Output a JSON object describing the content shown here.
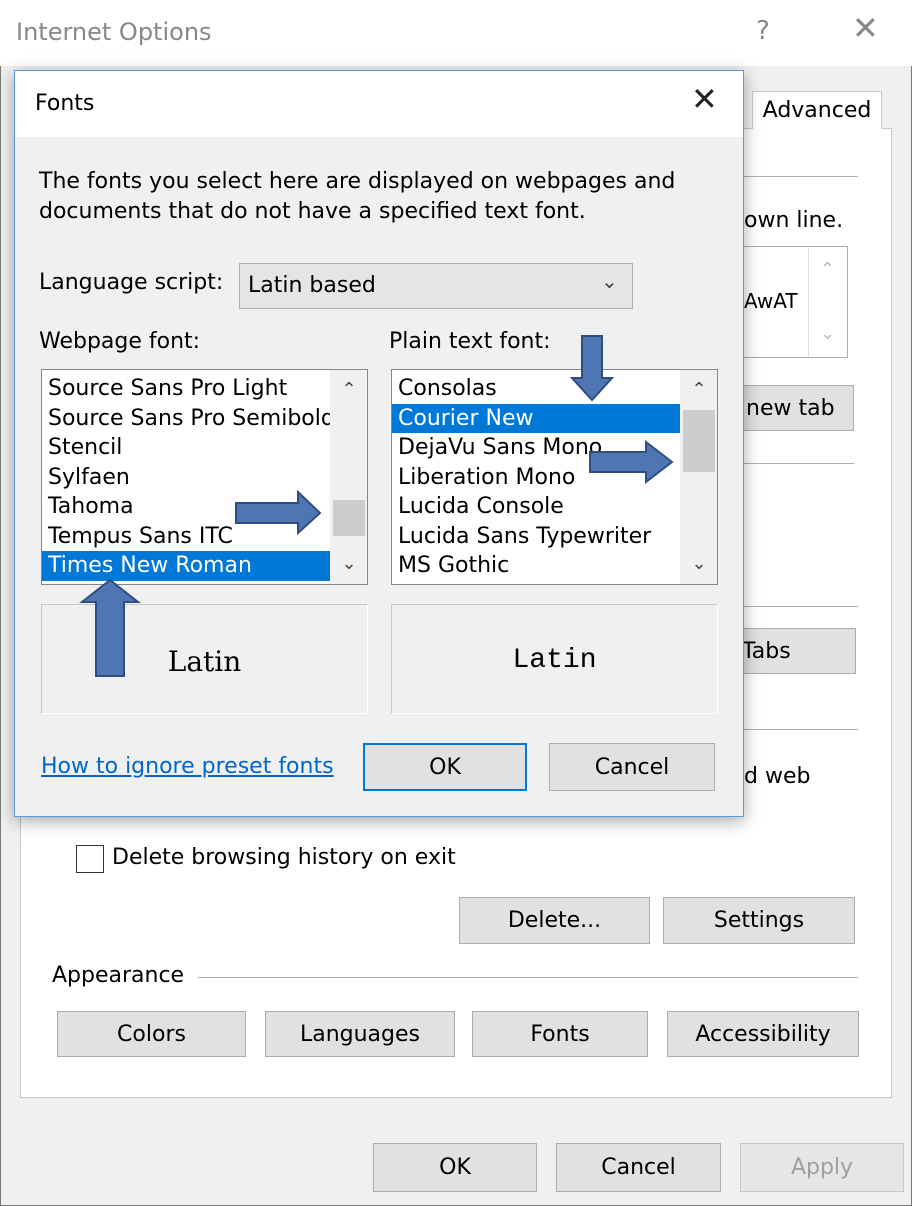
{
  "io_window": {
    "title": "Internet Options",
    "help_label": "?",
    "close_label": "✕",
    "tab_advanced": "Advanced",
    "frag_down_line": "own line.",
    "frag_preview": "AwAT",
    "frag_new_tab": "new tab",
    "frag_tabs": "Tabs",
    "frag_web": "d web",
    "delete_on_exit_label": "Delete browsing history on exit",
    "delete_on_exit_checked": false,
    "delete_button": "Delete...",
    "settings_button": "Settings",
    "appearance_label": "Appearance",
    "colors_button": "Colors",
    "languages_button": "Languages",
    "fonts_button": "Fonts",
    "accessibility_button": "Accessibility",
    "ok_button": "OK",
    "cancel_button": "Cancel",
    "apply_button": "Apply"
  },
  "fonts_dialog": {
    "title": "Fonts",
    "close_label": "✕",
    "description": "The fonts you select here are displayed on webpages and documents that do not have a specified text font.",
    "language_script_label": "Language script:",
    "language_script_value": "Latin based",
    "webpage_font_label": "Webpage font:",
    "plain_text_font_label": "Plain text font:",
    "webpage_fonts": [
      "Source Sans Pro Light",
      "Source Sans Pro Semibold",
      "Stencil",
      "Sylfaen",
      "Tahoma",
      "Tempus Sans ITC",
      "Times New Roman"
    ],
    "webpage_font_selected": "Times New Roman",
    "plain_text_fonts": [
      "Consolas",
      "Courier New",
      "DejaVu Sans Mono",
      "Liberation Mono",
      "Lucida Console",
      "Lucida Sans Typewriter",
      "MS Gothic"
    ],
    "plain_text_font_selected": "Courier New",
    "webpage_sample": "Latin",
    "plain_text_sample": "Latin",
    "help_link": "How to ignore preset fonts",
    "ok_button": "OK",
    "cancel_button": "Cancel"
  },
  "icons": {
    "scroll_up": "⌃",
    "scroll_down": "⌄",
    "dropdown_chevron": "⌄"
  },
  "colors": {
    "selection": "#0078d7",
    "link": "#0066cc",
    "annotation_arrow": "#4f75b3",
    "dialog_border": "#5b9bd5"
  }
}
